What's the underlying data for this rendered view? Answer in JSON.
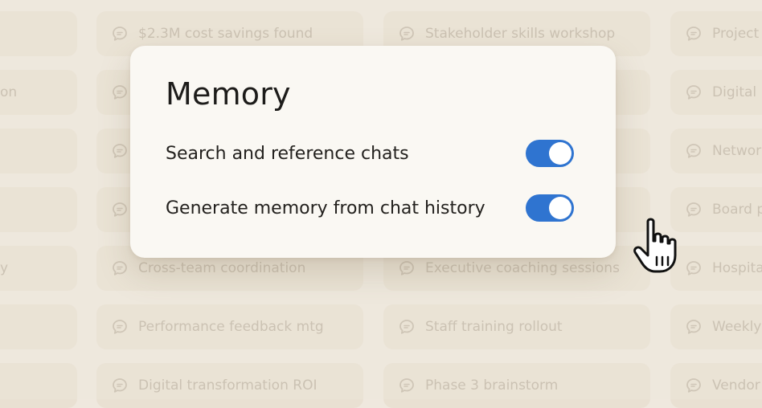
{
  "background_chats": {
    "col1": [
      "",
      "on",
      "",
      "",
      "y",
      "",
      ""
    ],
    "col2": [
      "$2.3M cost savings found",
      "",
      "",
      "",
      "Cross-team coordination",
      "Performance feedback mtg",
      "Digital transformation ROI"
    ],
    "col3": [
      "Stakeholder skills workshop",
      "",
      "",
      "",
      "Executive coaching sessions",
      "Staff training rollout",
      "Phase 3 brainstorm"
    ],
    "col4": [
      "Project",
      "Digital h",
      "Networ",
      "Board p",
      "Hospita",
      "Weekly",
      "Vendor"
    ]
  },
  "memory_panel": {
    "title": "Memory",
    "settings": [
      {
        "label": "Search and reference chats",
        "enabled": true
      },
      {
        "label": "Generate memory from chat history",
        "enabled": true
      }
    ]
  },
  "colors": {
    "background": "#efe8de",
    "chip": "#e9e0d2",
    "chip_text": "#b9ae9d",
    "card": "#faf8f3",
    "toggle_on": "#2f74d0"
  },
  "icons": {
    "chip": "chat-bubble-icon",
    "cursor": "hand-pointer-icon"
  }
}
